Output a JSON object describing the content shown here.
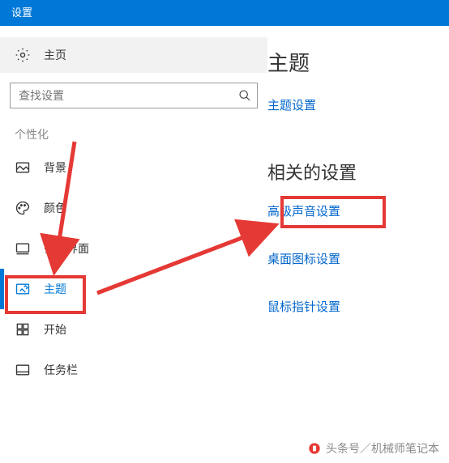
{
  "titlebar": {
    "title": "设置"
  },
  "sidebar": {
    "home_label": "主页",
    "search_placeholder": "查找设置",
    "section_label": "个性化",
    "items": [
      {
        "label": "背景"
      },
      {
        "label": "颜色"
      },
      {
        "label": "锁屏界面"
      },
      {
        "label": "主题"
      },
      {
        "label": "开始"
      },
      {
        "label": "任务栏"
      }
    ]
  },
  "main": {
    "heading": "主题",
    "theme_settings_link": "主题设置",
    "related_heading": "相关的设置",
    "links": [
      "高级声音设置",
      "桌面图标设置",
      "鼠标指针设置"
    ]
  },
  "watermark": {
    "text": "头条号／机械师笔记本"
  }
}
